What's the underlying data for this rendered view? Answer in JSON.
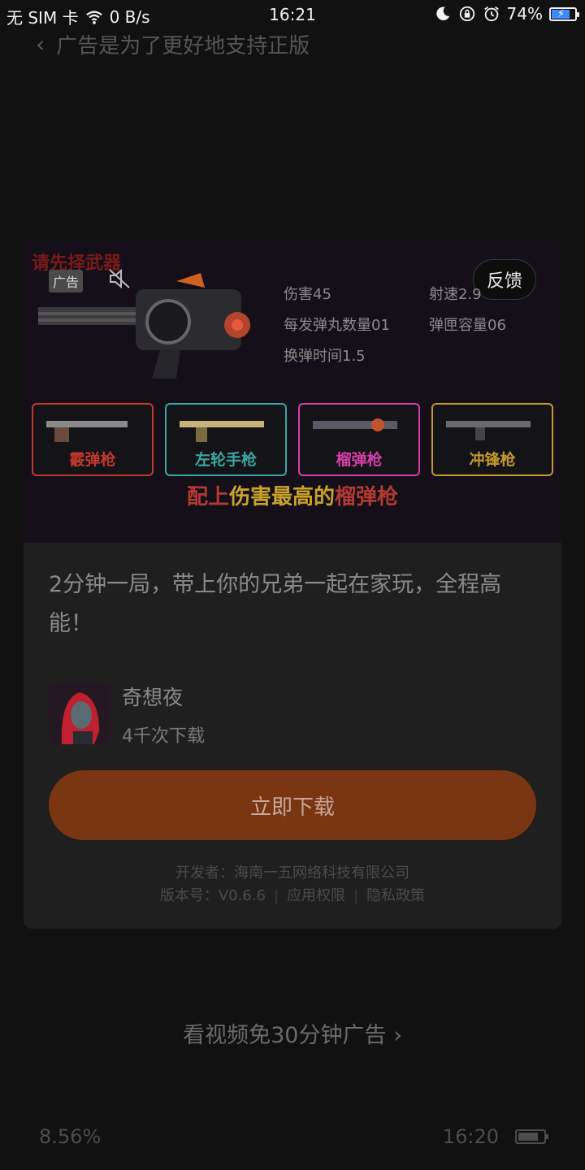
{
  "status_bar": {
    "carrier": "无 SIM 卡",
    "net_speed": "0 B/s",
    "time": "16:21",
    "battery_pct": "74%"
  },
  "nav": {
    "title": "广告是为了更好地支持正版"
  },
  "ad": {
    "badge": "广告",
    "feedback": "反馈",
    "banner": {
      "title": "请先择武器",
      "stats": {
        "damage": "伤害45",
        "fire_rate": "射速2.9",
        "pellets": "每发弹丸数量01",
        "magazine": "弹匣容量06",
        "reload": "换弹时间1.5"
      },
      "weapons": [
        {
          "label": "霰弹枪",
          "color": "#c0392b"
        },
        {
          "label": "左轮手枪",
          "color": "#3aa6a0"
        },
        {
          "label": "榴弹枪",
          "color": "#d63fa8"
        },
        {
          "label": "冲锋枪",
          "color": "#c49a2a"
        }
      ],
      "slogan_1": "配上",
      "slogan_2": "伤害最高的",
      "slogan_3": "榴弹枪"
    },
    "description": "2分钟一局，带上你的兄弟一起在家玩，全程高能！",
    "app_name": "奇想夜",
    "downloads": "4千次下载",
    "download_button": "立即下载",
    "developer": "开发者：海南一五网络科技有限公司",
    "version": "版本号：V0.6.6",
    "permissions": "应用权限",
    "privacy": "隐私政策"
  },
  "watch_video": "看视频免30分钟广告",
  "bottom": {
    "progress": "8.56%",
    "time": "16:20"
  }
}
